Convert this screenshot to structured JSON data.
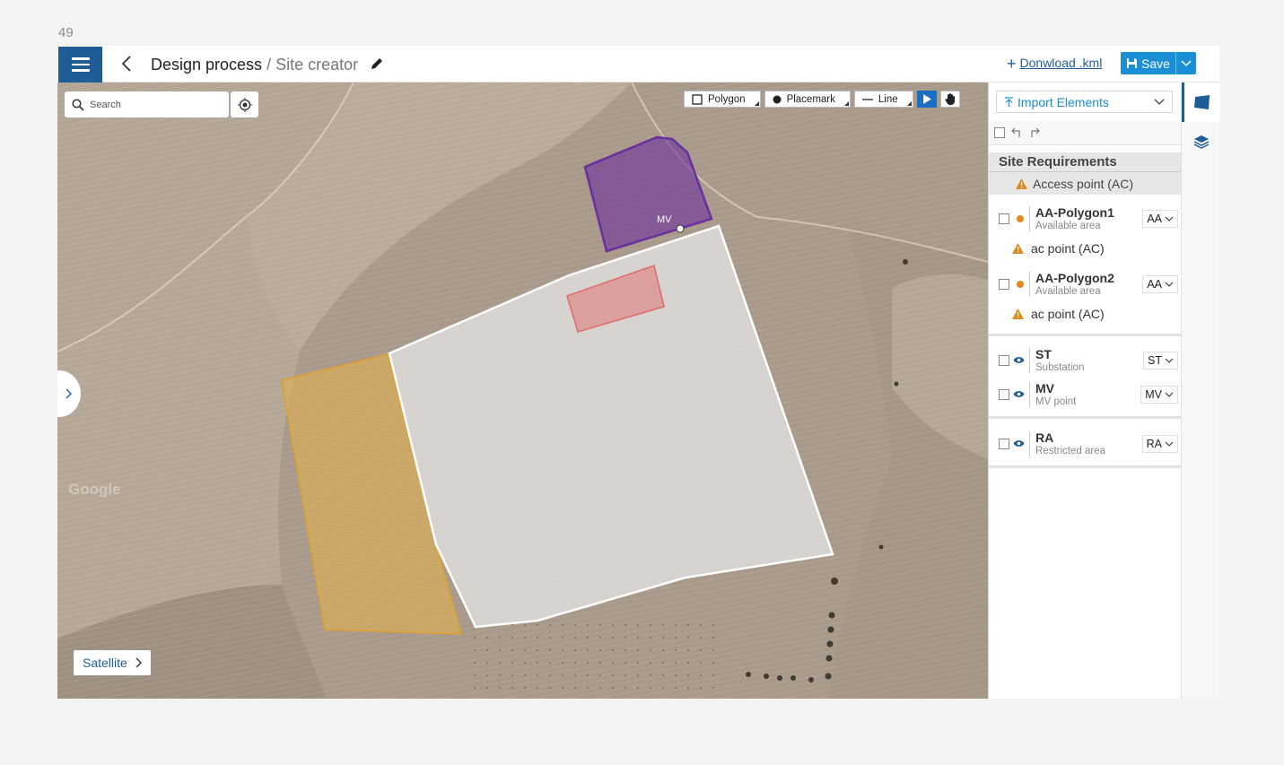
{
  "page_number": "49",
  "header": {
    "title": "Design process",
    "separator": " / ",
    "subtitle": "Site creator",
    "download_label": "Donwload .kml",
    "save_label": "Save"
  },
  "map": {
    "search_placeholder": "Search",
    "tools": {
      "polygon": "Polygon",
      "placemark": "Placemark",
      "line": "Line"
    },
    "mv_label": "MV",
    "watermark": "Google",
    "satellite_label": "Satellite",
    "colors": {
      "purple_zone": "#6a2f9e",
      "red_zone": "#e06b6b",
      "yellow_zone": "#e8b24a",
      "white_outline": "#ffffff"
    }
  },
  "panel": {
    "import_label": "Import Elements",
    "site_requirements_title": "Site Requirements",
    "site_requirements_warning": "Access point (AC)",
    "polygons": [
      {
        "name": "AA-Polygon1",
        "desc": "Available area",
        "tag": "AA",
        "warning": "ac point (AC)"
      },
      {
        "name": "AA-Polygon2",
        "desc": "Available area",
        "tag": "AA",
        "warning": "ac point (AC)"
      }
    ],
    "points": [
      {
        "name": "ST",
        "desc": "Substation",
        "tag": "ST"
      },
      {
        "name": "MV",
        "desc": "MV point",
        "tag": "MV"
      }
    ],
    "restricted": [
      {
        "name": "RA",
        "desc": "Restricted area",
        "tag": "RA"
      }
    ],
    "colors": {
      "accent": "#1a8fd6",
      "primary": "#1f5d99",
      "warning": "#e08a1e"
    }
  }
}
